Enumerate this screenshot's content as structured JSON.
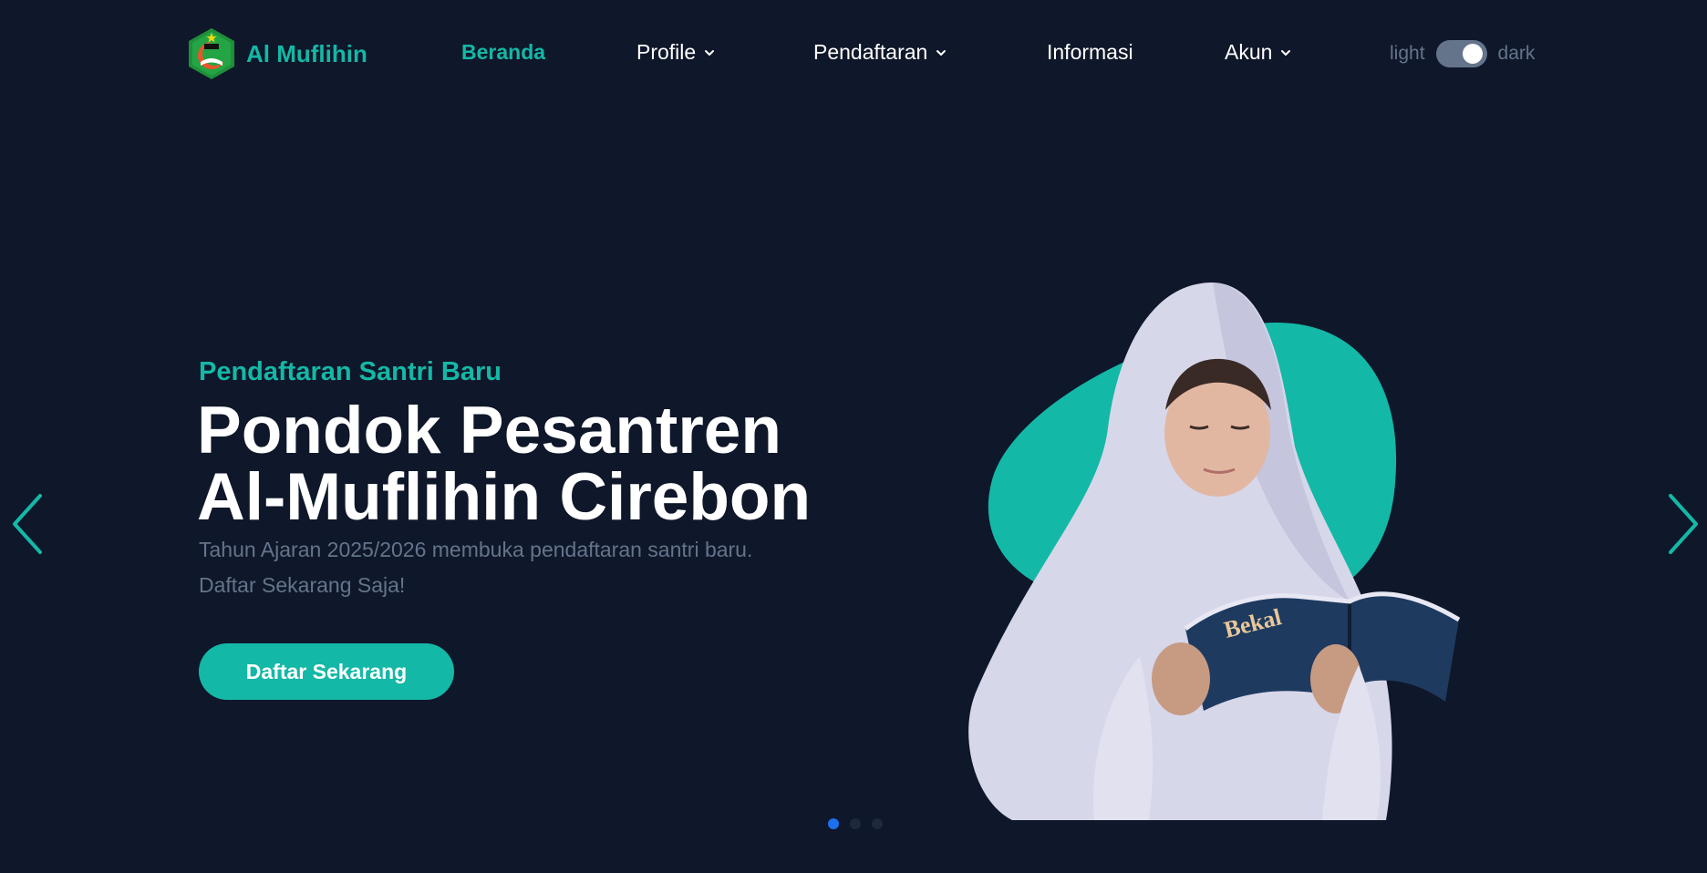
{
  "brand": {
    "name": "Al Muflihin",
    "logo_icon": "crescent-shield-logo"
  },
  "nav": {
    "items": [
      {
        "label": "Beranda",
        "active": true,
        "dropdown": false
      },
      {
        "label": "Profile",
        "active": false,
        "dropdown": true
      },
      {
        "label": "Pendaftaran",
        "active": false,
        "dropdown": true
      },
      {
        "label": "Informasi",
        "active": false,
        "dropdown": false
      },
      {
        "label": "Akun",
        "active": false,
        "dropdown": true
      }
    ]
  },
  "theme_toggle": {
    "light_label": "light",
    "dark_label": "dark",
    "state": "dark"
  },
  "hero": {
    "subtitle": "Pendaftaran Santri Baru",
    "title_line1": "Pondok Pesantren",
    "title_line2": "Al-Muflihin Cirebon",
    "description_line1": "Tahun Ajaran 2025/2026 membuka pendaftaran santri baru.",
    "description_line2": "Daftar Sekarang Saja!",
    "cta_label": "Daftar Sekarang",
    "book_cover_text": "Bekal"
  },
  "carousel": {
    "slide_count": 3,
    "active_index": 0
  },
  "colors": {
    "background": "#0f172a",
    "accent": "#14b8a6",
    "muted": "#64748b",
    "dot_active": "#1d6ff0"
  }
}
